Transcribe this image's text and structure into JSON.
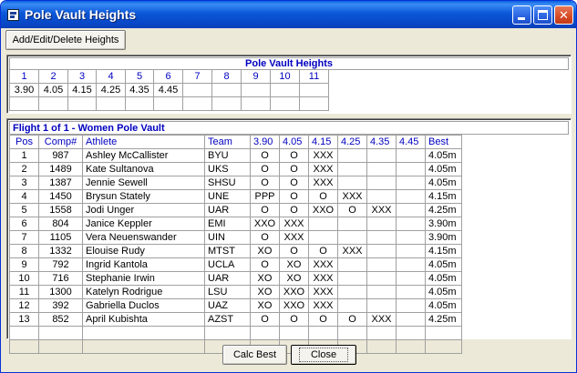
{
  "window": {
    "title": "Pole Vault Heights"
  },
  "toolbar": {
    "add_edit_delete_label": "Add/Edit/Delete Heights"
  },
  "heights_panel": {
    "caption": "Pole Vault Heights",
    "columns": [
      "1",
      "2",
      "3",
      "4",
      "5",
      "6",
      "7",
      "8",
      "9",
      "10",
      "11"
    ],
    "values": [
      "3.90",
      "4.05",
      "4.15",
      "4.25",
      "4.35",
      "4.45",
      "",
      "",
      "",
      "",
      ""
    ]
  },
  "flight_panel": {
    "caption": "Flight 1  of  1 - Women Pole Vault",
    "headers": [
      "Pos",
      "Comp#",
      "Athlete",
      "Team",
      "3.90",
      "4.05",
      "4.15",
      "4.25",
      "4.35",
      "4.45",
      "Best"
    ],
    "rows": [
      [
        "1",
        "987",
        "Ashley McCallister",
        "BYU",
        "O",
        "O",
        "XXX",
        "",
        "",
        "",
        "4.05m"
      ],
      [
        "2",
        "1489",
        "Kate Sultanova",
        "UKS",
        "O",
        "O",
        "XXX",
        "",
        "",
        "",
        "4.05m"
      ],
      [
        "3",
        "1387",
        "Jennie Sewell",
        "SHSU",
        "O",
        "O",
        "XXX",
        "",
        "",
        "",
        "4.05m"
      ],
      [
        "4",
        "1450",
        "Brysun Stately",
        "UNE",
        "PPP",
        "O",
        "O",
        "XXX",
        "",
        "",
        "4.15m"
      ],
      [
        "5",
        "1558",
        "Jodi Unger",
        "UAR",
        "O",
        "O",
        "XXO",
        "O",
        "XXX",
        "",
        "4.25m"
      ],
      [
        "6",
        "804",
        "Janice Keppler",
        "EMI",
        "XXO",
        "XXX",
        "",
        "",
        "",
        "",
        "3.90m"
      ],
      [
        "7",
        "1105",
        "Vera Neuenswander",
        "UIN",
        "O",
        "XXX",
        "",
        "",
        "",
        "",
        "3.90m"
      ],
      [
        "8",
        "1332",
        "Elouise Rudy",
        "MTST",
        "XO",
        "O",
        "O",
        "XXX",
        "",
        "",
        "4.15m"
      ],
      [
        "9",
        "792",
        "Ingrid Kantola",
        "UCLA",
        "O",
        "XO",
        "XXX",
        "",
        "",
        "",
        "4.05m"
      ],
      [
        "10",
        "716",
        "Stephanie Irwin",
        "UAR",
        "XO",
        "XO",
        "XXX",
        "",
        "",
        "",
        "4.05m"
      ],
      [
        "11",
        "1300",
        "Katelyn Rodrigue",
        "LSU",
        "XO",
        "XXO",
        "XXX",
        "",
        "",
        "",
        "4.05m"
      ],
      [
        "12",
        "392",
        "Gabriella Duclos",
        "UAZ",
        "XO",
        "XXO",
        "XXX",
        "",
        "",
        "",
        "4.05m"
      ],
      [
        "13",
        "852",
        "April Kubishta",
        "AZST",
        "O",
        "O",
        "O",
        "O",
        "XXX",
        "",
        "4.25m"
      ]
    ]
  },
  "footer": {
    "calc_best_label": "Calc Best",
    "close_label": "Close"
  },
  "colors": {
    "titlebar": "#0a58d8",
    "header_text": "#0000c0",
    "window_bg": "#ece9d8"
  }
}
